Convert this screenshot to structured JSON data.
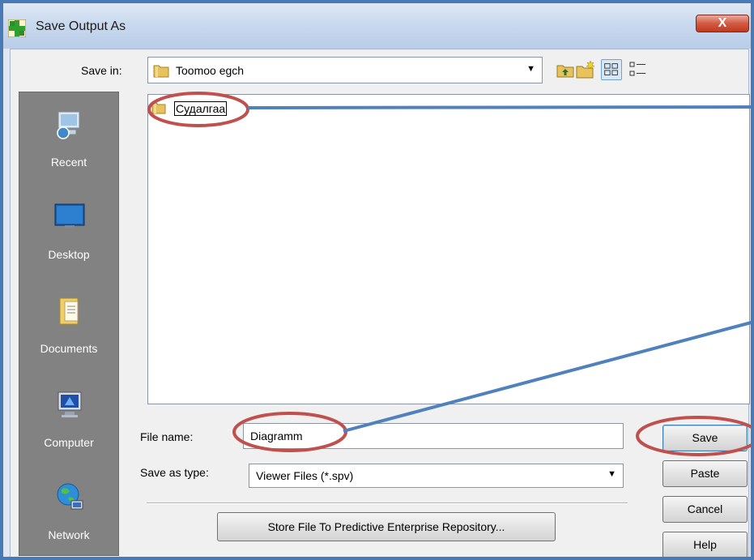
{
  "window": {
    "title": "Save Output As",
    "close_glyph": "X"
  },
  "save_in": {
    "label": "Save in:",
    "value": "Toomoo egch",
    "icon": "folder-icon"
  },
  "toolbar": {
    "icons": [
      "up-one-level-icon",
      "create-new-folder-icon",
      "list-view-icon",
      "details-view-icon"
    ]
  },
  "places": [
    {
      "label": "Recent",
      "icon": "recent-icon"
    },
    {
      "label": "Desktop",
      "icon": "desktop-icon"
    },
    {
      "label": "Documents",
      "icon": "documents-icon"
    },
    {
      "label": "Computer",
      "icon": "computer-icon"
    },
    {
      "label": "Network",
      "icon": "network-icon"
    }
  ],
  "file_list": {
    "items": [
      {
        "name": "Судалгаа",
        "icon": "folder-icon"
      }
    ]
  },
  "file_name": {
    "label": "File name:",
    "value": "Diagramm"
  },
  "save_as_type": {
    "label": "Save as type:",
    "value": "Viewer Files (*.spv)"
  },
  "buttons": {
    "store": "Store File To Predictive Enterprise Repository...",
    "save": "Save",
    "paste": "Paste",
    "cancel": "Cancel",
    "help": "Help"
  },
  "colors": {
    "frame": "#4a7ab6",
    "annotation_circle": "#c0504d",
    "annotation_line": "#4f81bd",
    "places_bar": "#828282"
  }
}
